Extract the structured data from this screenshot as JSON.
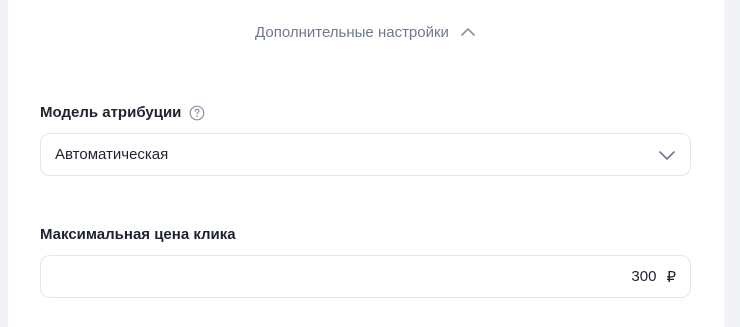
{
  "advanced": {
    "label": "Дополнительные настройки",
    "state": "expanded",
    "icon": "chevron-up-icon"
  },
  "attribution": {
    "label": "Модель атрибуции",
    "help_icon": "question-circle-icon",
    "selected_value": "Автоматическая",
    "dropdown_icon": "chevron-down-icon"
  },
  "max_click_price": {
    "label": "Максимальная цена клика",
    "value": "300",
    "currency": "₽"
  },
  "colors": {
    "page_background": "#f2f3f7",
    "card_background": "#ffffff",
    "muted_text": "#6f7a8c",
    "main_text": "#1e2330",
    "border": "#e3e6ec"
  }
}
